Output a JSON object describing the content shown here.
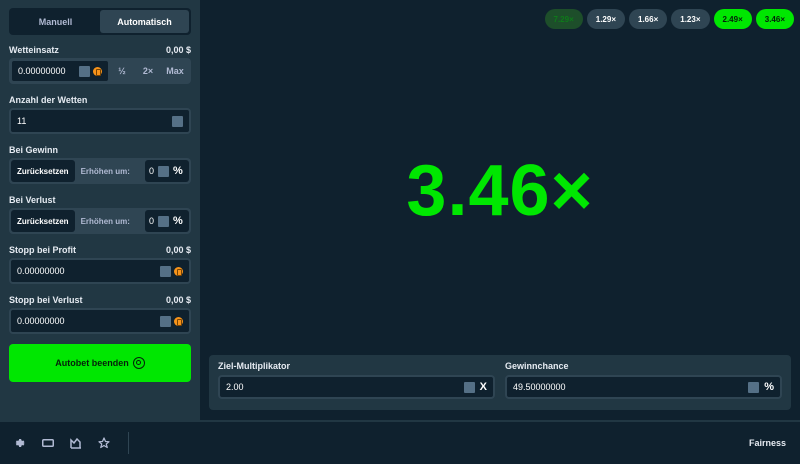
{
  "mode_tabs": [
    "Manuell",
    "Automatisch"
  ],
  "bet_amount": {
    "label": "Wetteinsatz",
    "fiat": "0,00 $",
    "value": "0.00000000",
    "half": "½",
    "double": "2×",
    "max": "Max"
  },
  "number_of_bets": {
    "label": "Anzahl der Wetten",
    "value": "11"
  },
  "on_win": {
    "label": "Bei Gewinn",
    "reset": "Zurücksetzen",
    "increase": "Erhöhen um:",
    "value": "0",
    "unit": "%"
  },
  "on_loss": {
    "label": "Bei Verlust",
    "reset": "Zurücksetzen",
    "increase": "Erhöhen um:",
    "value": "0",
    "unit": "%"
  },
  "stop_profit": {
    "label": "Stopp bei Profit",
    "fiat": "0,00 $",
    "value": "0.00000000"
  },
  "stop_loss": {
    "label": "Stopp bei Verlust",
    "fiat": "0,00 $",
    "value": "0.00000000"
  },
  "autobet_button": "Autobet beenden",
  "history": [
    "7.29×",
    "1.29×",
    "1.66×",
    "1.23×",
    "2.49×",
    "3.46×"
  ],
  "multiplier": "3.46×",
  "target_multiplier": {
    "label": "Ziel-Multiplikator",
    "value": "2.00",
    "suffix": "X"
  },
  "win_chance": {
    "label": "Gewinnchance",
    "value": "49.50000000",
    "suffix": "%"
  },
  "footer": {
    "fairness": "Fairness"
  },
  "icons": [
    "gear-icon",
    "theater-icon",
    "stats-icon",
    "star-icon",
    "bitcoin-icon",
    "target-icon"
  ],
  "colors": {
    "accent_green": "#00e701",
    "panel": "#213743",
    "background": "#0f212e",
    "input": "#2f4553"
  }
}
